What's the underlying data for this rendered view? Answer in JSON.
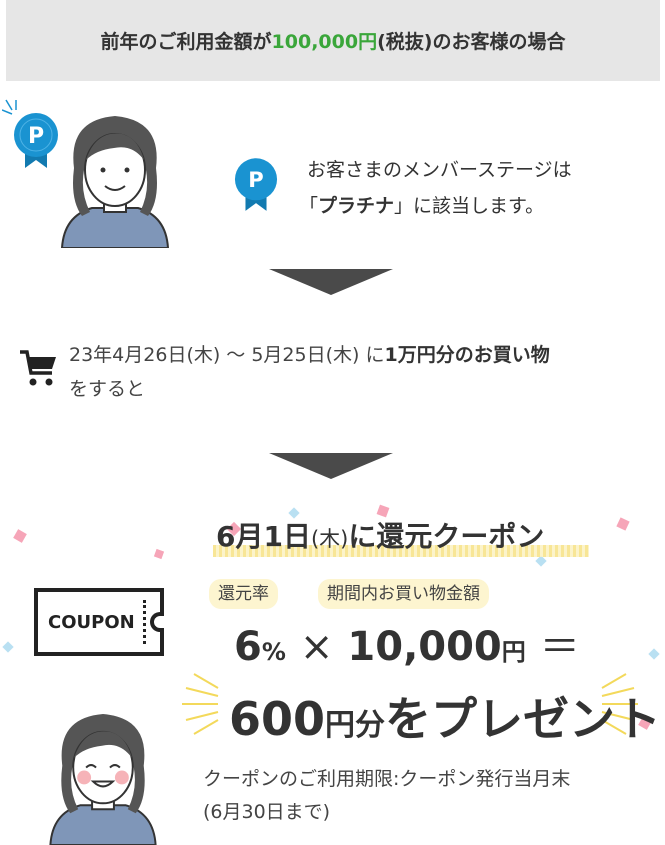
{
  "header": {
    "prefix": "前年のご利用金額が",
    "amount": "100,000円",
    "suffix": " (税抜)のお客様の場合"
  },
  "stage": {
    "badge_letter": "P",
    "line1": "お客さまのメンバーステージは",
    "line2_open": "「",
    "line2_stage": "プラチナ",
    "line2_close": "」に該当します。"
  },
  "period": {
    "line1_prefix": "23年4月26日(木) 〜 5月25日(木) に",
    "line1_bold": "1万円分のお買い物",
    "line2": "をすると"
  },
  "coupon": {
    "title_date": "6月1日",
    "title_day": "(木)",
    "title_rest": "に還元クーポン",
    "ticket_label": "COUPON",
    "pill_rate": "還元率",
    "pill_amount": "期間内お買い物金額",
    "rate_value": "6",
    "rate_unit": "%",
    "times": "×",
    "amount_value": "10,000",
    "amount_unit": "円",
    "equals": "＝",
    "present_value": "600",
    "present_unit": "円分",
    "present_rest": "をプレゼント",
    "expiry_line1": "クーポンのご利用期限:クーポン発行当月末",
    "expiry_line2": "(6月30日まで)"
  },
  "colors": {
    "accent_green": "#3aa63a",
    "badge_blue": "#1a93d1",
    "highlight_yellow": "#fdf5d0"
  },
  "icons": [
    "p-badge-icon",
    "person-icon",
    "down-arrow-icon",
    "cart-icon",
    "coupon-ticket-icon",
    "sparkle-icon",
    "confetti-icon"
  ]
}
